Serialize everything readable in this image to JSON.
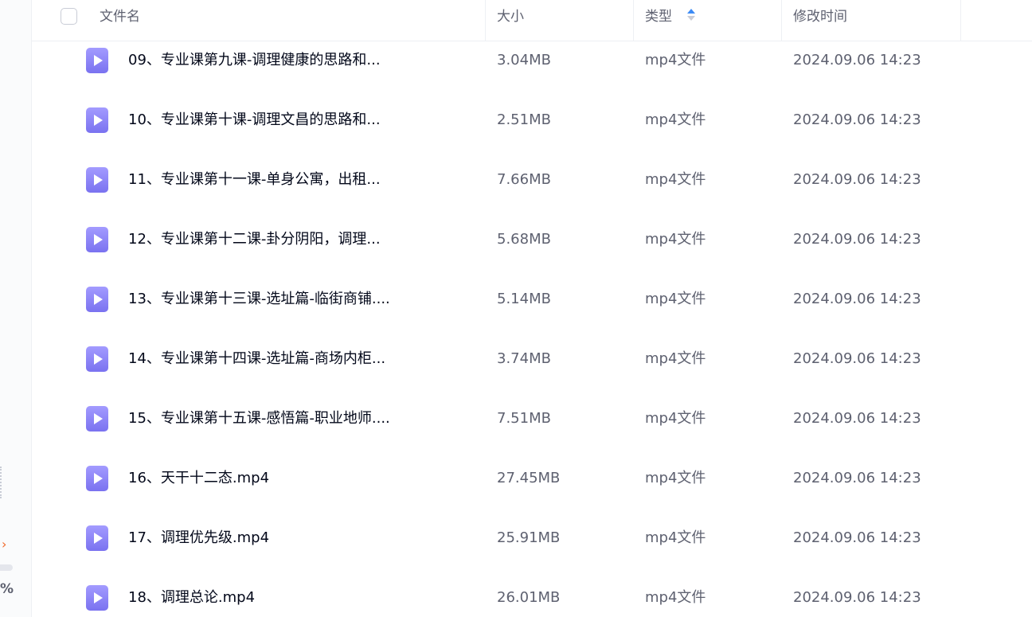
{
  "columns": {
    "name": "文件名",
    "size": "大小",
    "type": "类型",
    "modified": "修改时间"
  },
  "sidebar": {
    "arrow": "›",
    "percent": "%"
  },
  "files": [
    {
      "name": "09、专业课第九课-调理健康的思路和...",
      "size": "3.04MB",
      "type": "mp4文件",
      "modified": "2024.09.06 14:23"
    },
    {
      "name": "10、专业课第十课-调理文昌的思路和...",
      "size": "2.51MB",
      "type": "mp4文件",
      "modified": "2024.09.06 14:23"
    },
    {
      "name": "11、专业课第十一课-单身公寓，出租...",
      "size": "7.66MB",
      "type": "mp4文件",
      "modified": "2024.09.06 14:23"
    },
    {
      "name": "12、专业课第十二课-卦分阴阳，调理...",
      "size": "5.68MB",
      "type": "mp4文件",
      "modified": "2024.09.06 14:23"
    },
    {
      "name": "13、专业课第十三课-选址篇-临街商铺....",
      "size": "5.14MB",
      "type": "mp4文件",
      "modified": "2024.09.06 14:23"
    },
    {
      "name": "14、专业课第十四课-选址篇-商场内柜...",
      "size": "3.74MB",
      "type": "mp4文件",
      "modified": "2024.09.06 14:23"
    },
    {
      "name": "15、专业课第十五课-感悟篇-职业地师....",
      "size": "7.51MB",
      "type": "mp4文件",
      "modified": "2024.09.06 14:23"
    },
    {
      "name": "16、天干十二态.mp4",
      "size": "27.45MB",
      "type": "mp4文件",
      "modified": "2024.09.06 14:23"
    },
    {
      "name": "17、调理优先级.mp4",
      "size": "25.91MB",
      "type": "mp4文件",
      "modified": "2024.09.06 14:23"
    },
    {
      "name": "18、调理总论.mp4",
      "size": "26.01MB",
      "type": "mp4文件",
      "modified": "2024.09.06 14:23"
    }
  ],
  "colors": {
    "accent": "#3d8bf5",
    "file_icon": "#8b83f7",
    "text_primary": "#03081a",
    "text_secondary": "#5e6170"
  },
  "icons": {
    "file": "video-file-icon",
    "sort": "sort-ascending-icon"
  }
}
